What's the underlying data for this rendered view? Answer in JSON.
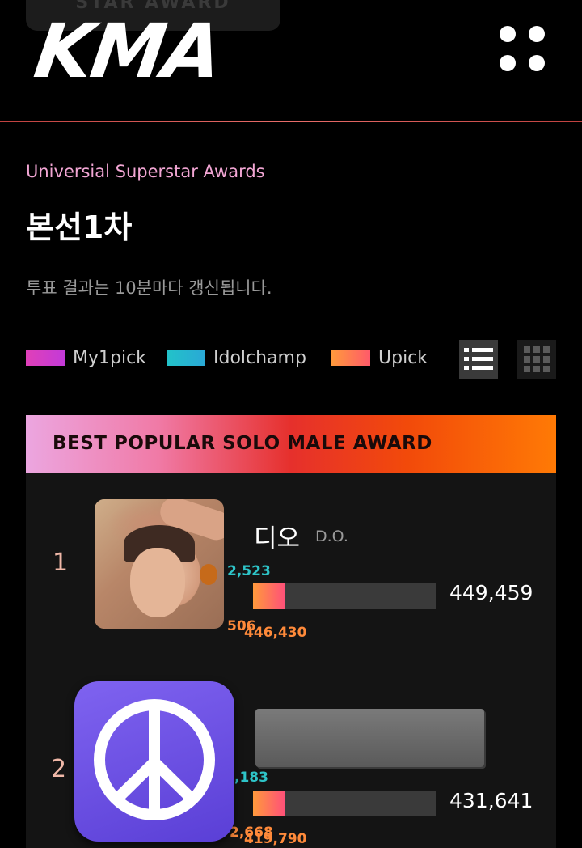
{
  "header": {
    "star_tab_label": "STAR AWARD",
    "logo_text": "KMA"
  },
  "page": {
    "subtitle": "Universial Superstar Awards",
    "title": "본선1차",
    "notice": "투표 결과는 10분마다 갱신됩니다."
  },
  "legend": [
    {
      "label": "My1pick",
      "color": "#e040b8"
    },
    {
      "label": "Idolchamp",
      "color": "#22c3c9"
    },
    {
      "label": "Upick",
      "color": "#ff7b3a"
    }
  ],
  "award": {
    "title": "BEST POPULAR SOLO MALE AWARD",
    "entries": [
      {
        "rank": "1",
        "name_ko": "디오",
        "name_en": "D.O.",
        "idolchamp": "2,523",
        "my1pick": "506",
        "upick": "446,430",
        "total": "449,459"
      },
      {
        "rank": "2",
        "idolchamp": ",183",
        "my1pick": "2,668",
        "upick": "419,790",
        "total": "431,641"
      }
    ]
  },
  "colors": {
    "accent_line": "#e06060",
    "bar_fill_start": "#ff9a3c",
    "bar_fill_end": "#ff4f7a"
  }
}
